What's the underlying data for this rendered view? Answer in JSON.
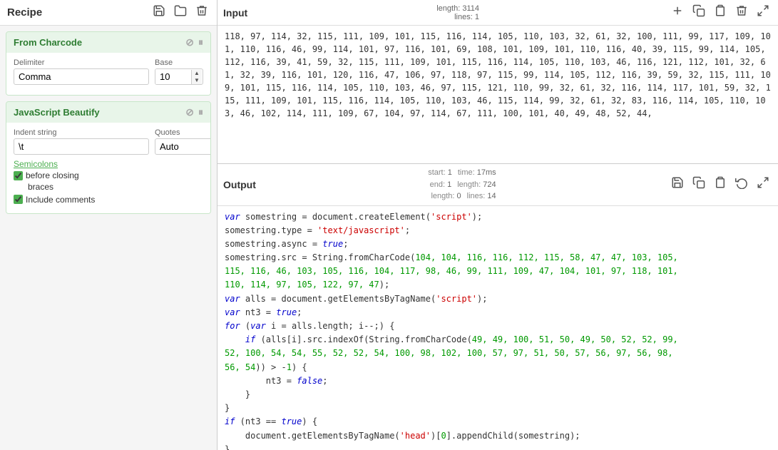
{
  "left": {
    "recipe_title": "Recipe",
    "icons": {
      "save": "💾",
      "folder": "📁",
      "delete": "🗑"
    },
    "from_charcode": {
      "title": "From Charcode",
      "delimiter_label": "Delimiter",
      "delimiter_value": "Comma",
      "base_label": "Base",
      "base_value": "10"
    },
    "js_beautify": {
      "title": "JavaScript Beautify",
      "indent_label": "Indent string",
      "indent_value": "\\t",
      "quotes_label": "Quotes",
      "quotes_value": "Auto",
      "semicolons_label": "Semicolons",
      "before_closing_label": "before closing",
      "braces_label": "braces",
      "include_comments_label": "Include comments"
    }
  },
  "input": {
    "title": "Input",
    "length_label": "length:",
    "length_value": "3114",
    "lines_label": "lines:",
    "lines_value": "1",
    "content": "118, 97, 114, 32, 115, 111, 109, 101, 115, 116, 114, 105, 110, 103, 32, 61, 32, 100, 111, 99, 117, 109, 101, 110, 116, 46, 99, 114, 101, 97, 116, 101, 69, 108, 101, 109, 101, 110, 116, 40, 39, 115, 99, 114, 105, 112, 116, 39, 41, 59, 32, 115, 111, 109, 101, 115, 116, 114, 105, 110, 103, 46, 116, 121, 112, 101, 32, 61, 32, 39, 116, 101, 120, 116, 47, 106, 97, 118, 97, 115, 99, 114, 105, 112, 116, 39, 59, 32, 115, 111, 109, 101, 115, 116, 114, 105, 110, 103, 46, 97, 115, 121, 110, 99, 32, 61, 32, 116, 114, 117, 101, 59, 32, 115, 111, 109, 101, 115, 116, 114, 105, 110, 103, 46, 115, 114, 99, 32, 61, 32, 83, 116, 114, 105, 110, 103, 46, 102, 114, 111, 109, 67, 104, 97, 114, 67, 111, 100, 101, 40, 49, 48, 52, 44,"
  },
  "output": {
    "title": "Output",
    "start_label": "start:",
    "start_value": "1",
    "time_label": "time:",
    "time_value": "17ms",
    "end_label": "end:",
    "end_value": "1",
    "length_label2": "length:",
    "length_value2": "724",
    "length_label3": "length:",
    "length_value3": "0",
    "lines_label": "lines:",
    "lines_value": "14",
    "lines_label2": "lines:",
    "lines_value2": "14"
  }
}
